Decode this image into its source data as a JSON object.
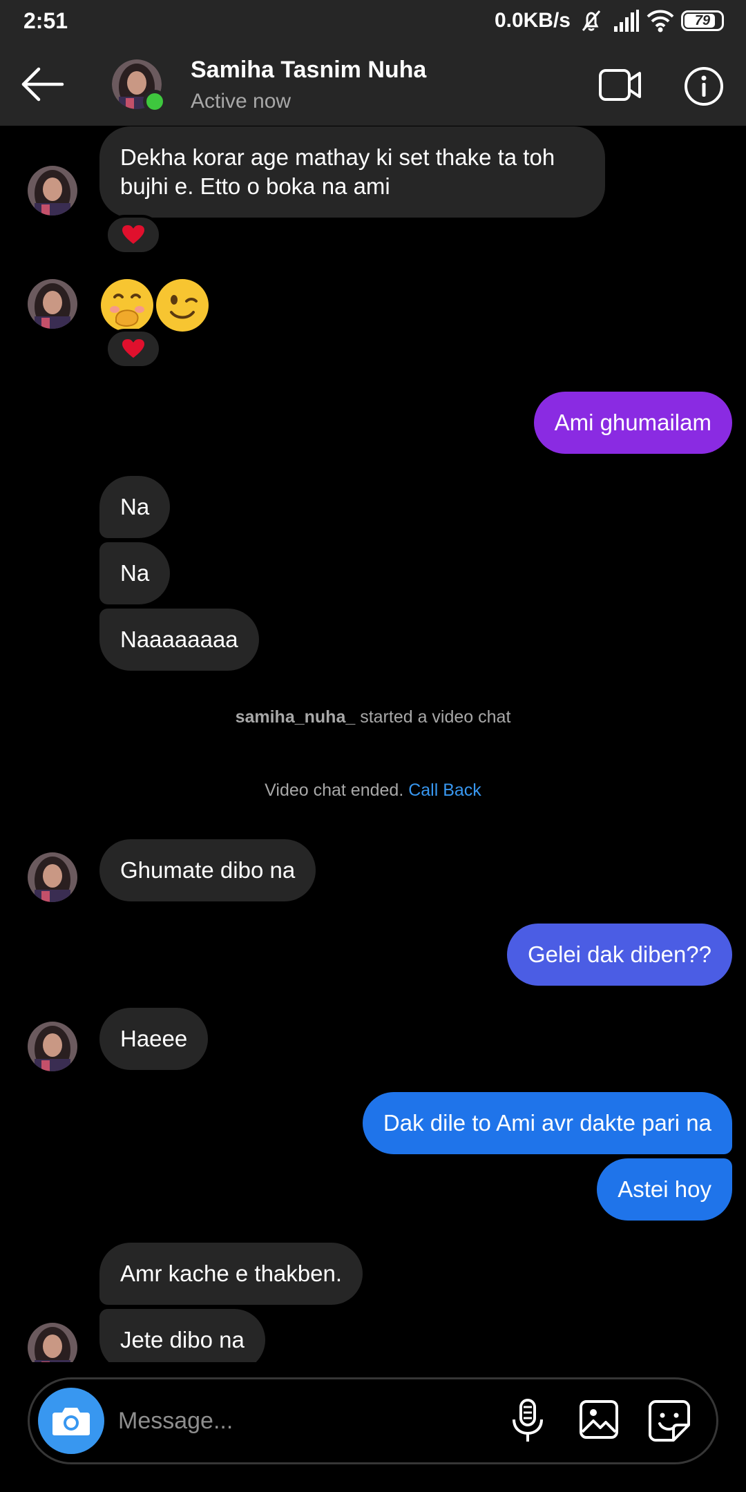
{
  "status_bar": {
    "time": "2:51",
    "network_speed": "0.0KB/s",
    "battery_level": "79",
    "battery_fraction": 0.79,
    "icons": [
      "mute-icon",
      "signal-icon",
      "wifi-icon",
      "battery-icon"
    ]
  },
  "header": {
    "contact_name": "Samiha Tasnim Nuha",
    "status": "Active now",
    "icons": [
      "back-arrow-icon",
      "video-camera-icon",
      "info-icon"
    ]
  },
  "messages": {
    "m1": "Dekha korar age mathay ki set thake ta toh",
    "m1b": "bujhi e. Etto o boka na ami",
    "m3": "Ami ghumailam",
    "m4": "Na",
    "m5": "Na",
    "m6": "Naaaaaaaa",
    "m7": "Ghumate dibo na",
    "m8": "Gelei dak diben??",
    "m9": "Haeee",
    "m10": "Dak dile to Ami avr dakte pari na",
    "m11": "Astei hoy",
    "m12": "Amr kache e thakben.",
    "m13": "Jete dibo na"
  },
  "system": {
    "video_user": "samiha_nuha_",
    "video_started": " started a video chat",
    "video_ended": "Video chat ended. ",
    "call_back": "Call Back"
  },
  "composer": {
    "placeholder": "Message...",
    "icons": [
      "camera-icon",
      "microphone-icon",
      "gallery-icon",
      "sticker-icon"
    ]
  },
  "colors": {
    "purple_bubble": "#8a2be2",
    "blue_purple_bubble": "#4b5de4",
    "blue_bubble": "#1f74ea",
    "incoming_bubble": "#262626",
    "accent": "#3897f0",
    "online": "#3ec73e",
    "reaction_heart": "#e0102d"
  }
}
